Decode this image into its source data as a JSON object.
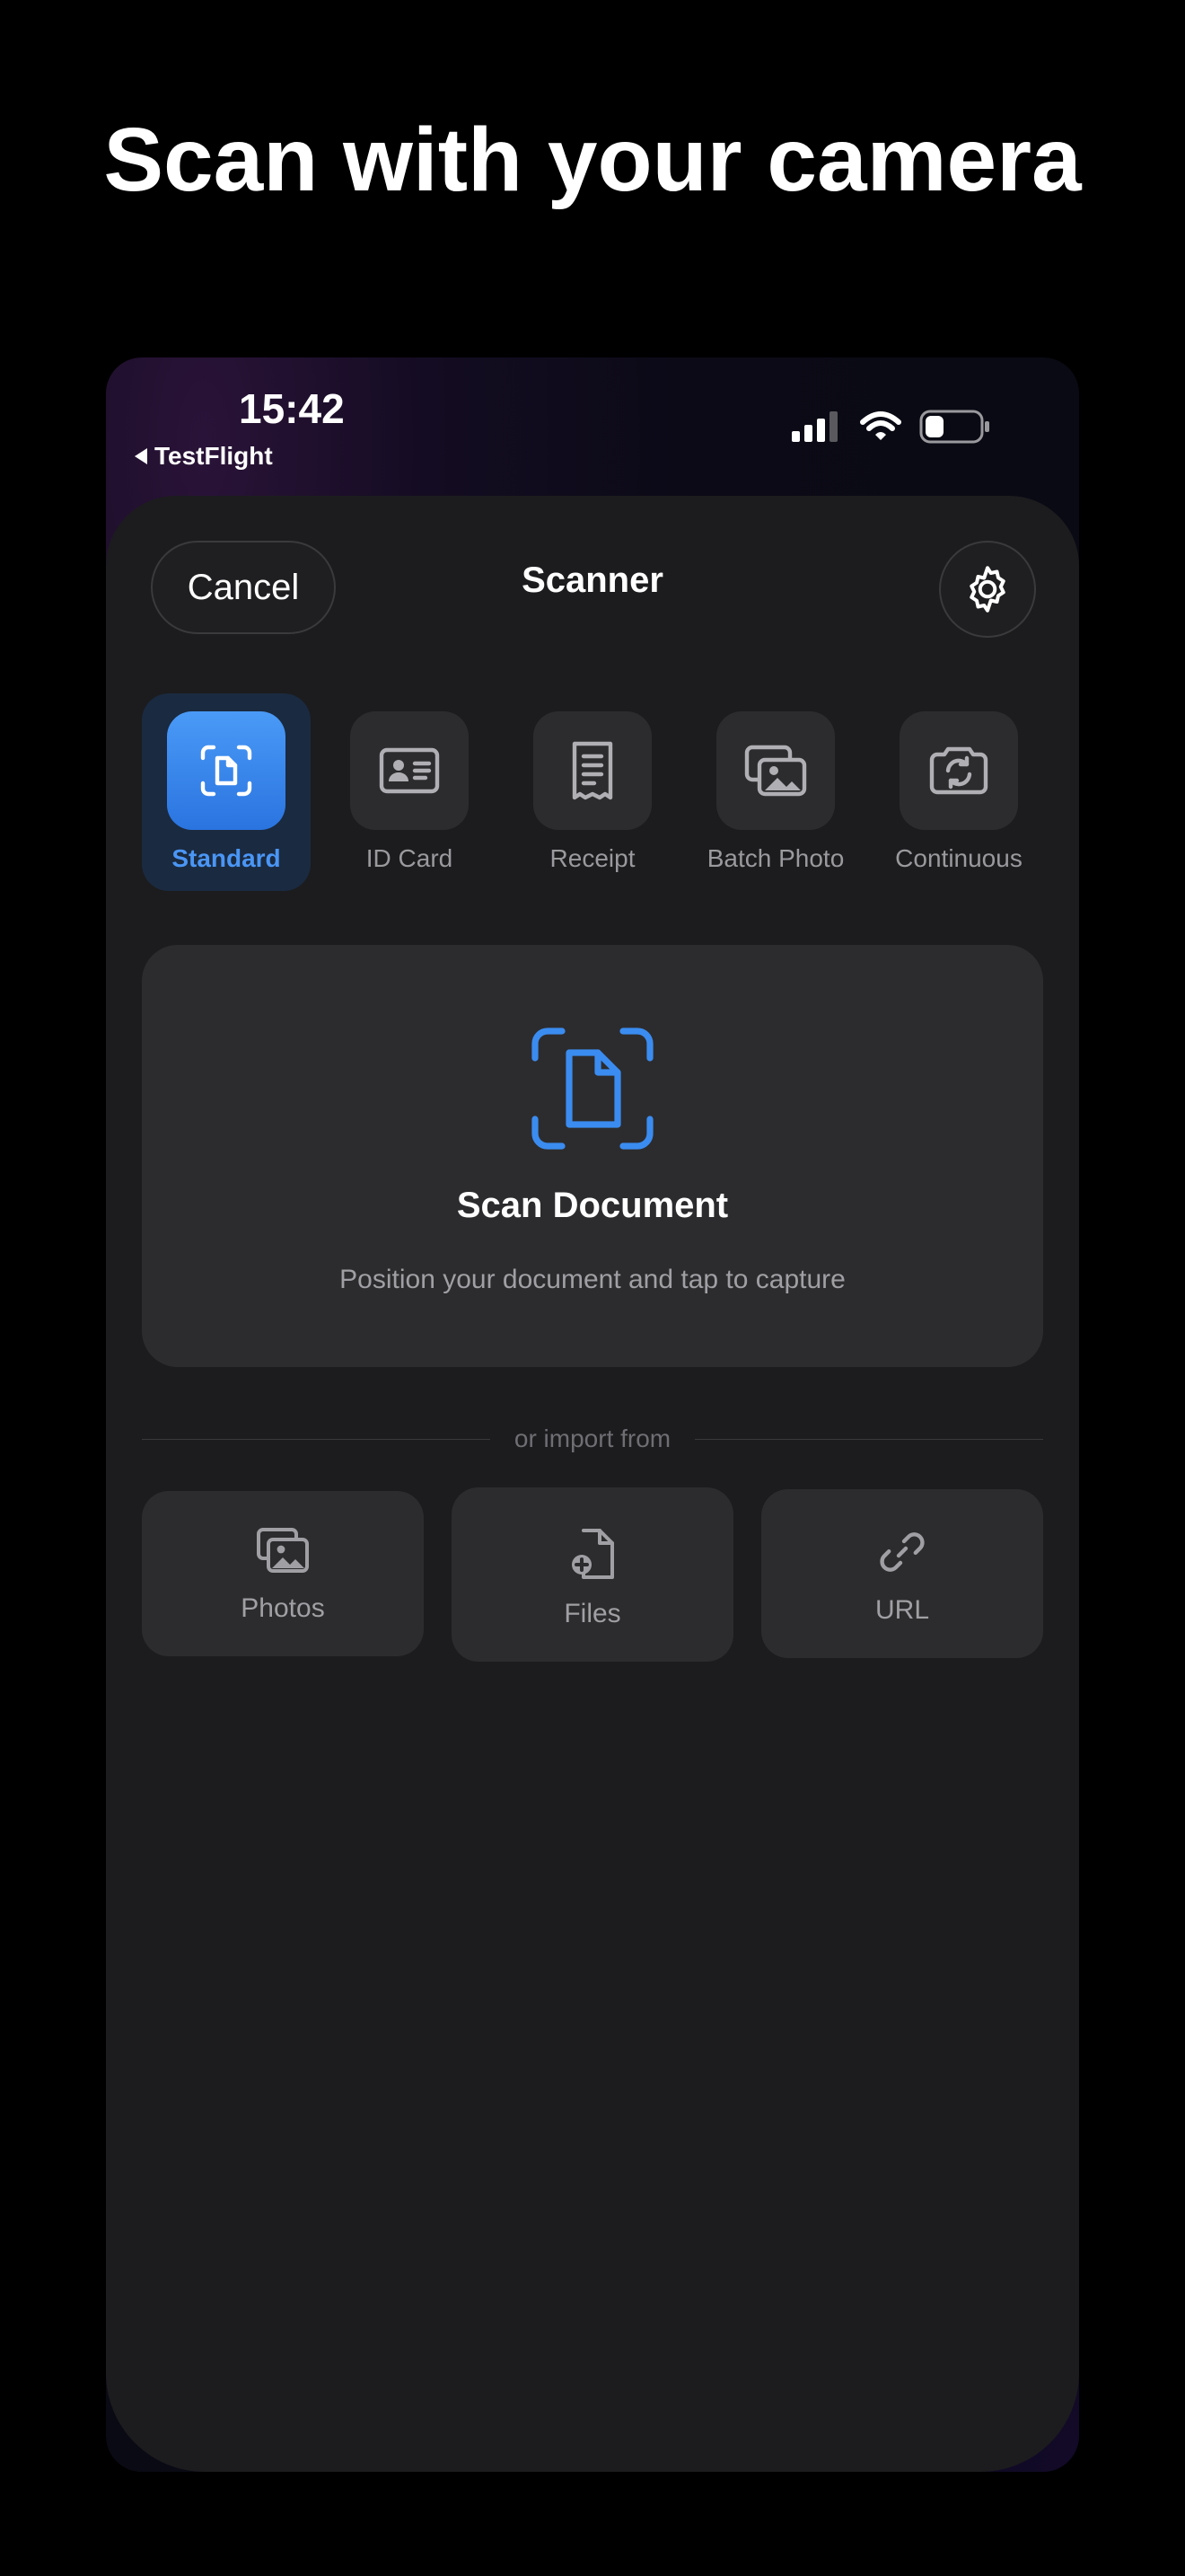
{
  "headline": "Scan with your camera",
  "status_bar": {
    "time": "15:42",
    "back_app": "TestFlight",
    "icons": [
      "cellular-signal-icon",
      "wifi-icon",
      "battery-icon"
    ],
    "battery_level": 0.35
  },
  "header": {
    "cancel_label": "Cancel",
    "title": "Scanner",
    "settings_icon": "gear-icon"
  },
  "modes": [
    {
      "label": "Standard",
      "icon": "document-scan-icon",
      "selected": true
    },
    {
      "label": "ID Card",
      "icon": "id-card-icon",
      "selected": false
    },
    {
      "label": "Receipt",
      "icon": "receipt-icon",
      "selected": false
    },
    {
      "label": "Batch Photo",
      "icon": "photo-stack-icon",
      "selected": false
    },
    {
      "label": "Continuous",
      "icon": "camera-rotate-icon",
      "selected": false
    }
  ],
  "scan_card": {
    "title": "Scan Document",
    "subtitle": "Position your document and tap to capture",
    "icon": "document-viewfinder-icon"
  },
  "import": {
    "divider_text": "or import from",
    "options": [
      {
        "label": "Photos",
        "icon": "photos-icon"
      },
      {
        "label": "Files",
        "icon": "file-add-icon"
      },
      {
        "label": "URL",
        "icon": "link-icon"
      }
    ]
  },
  "colors": {
    "accent": "#3b8cf0",
    "sheet_bg": "#1c1c1e",
    "card_bg": "#2c2c2e",
    "muted_text": "#a0a0a4"
  }
}
